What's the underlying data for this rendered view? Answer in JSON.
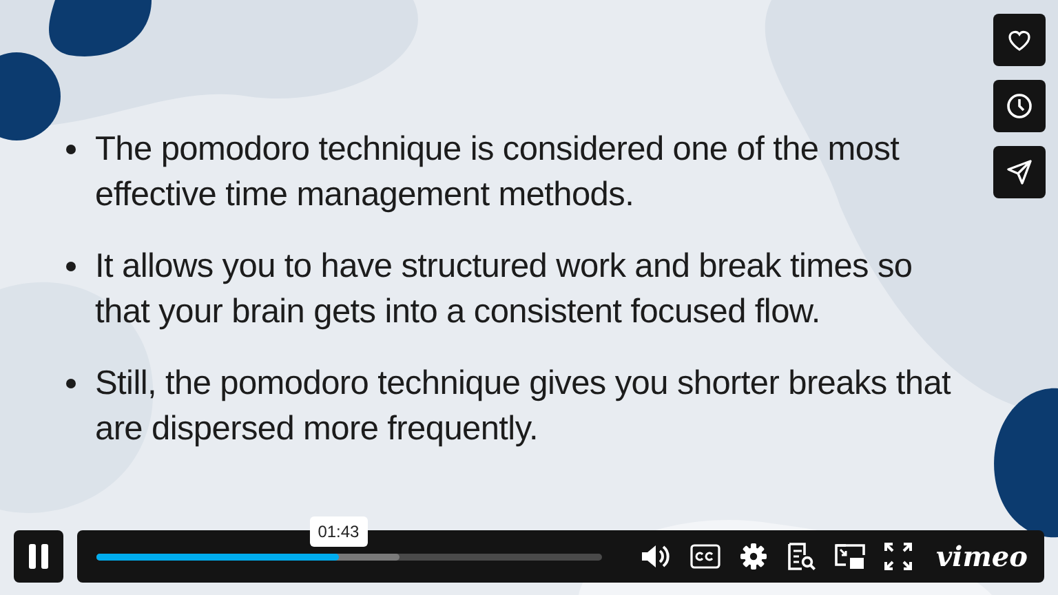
{
  "slide": {
    "bullets": [
      "The pomodoro technique is considered one of the most effective time management methods.",
      "It allows you to have structured work and break times so that your brain gets into a consistent focused flow.",
      "Still, the pomodoro technique gives you shorter breaks that are dispersed more frequently."
    ]
  },
  "side_buttons": [
    {
      "kind": "like"
    },
    {
      "kind": "later"
    },
    {
      "kind": "share"
    }
  ],
  "player": {
    "playing": true,
    "progress": {
      "level": 0.48
    },
    "buffered": {
      "level": 0.6
    },
    "time_tooltip": "01:43",
    "logo": "vimeo"
  }
}
